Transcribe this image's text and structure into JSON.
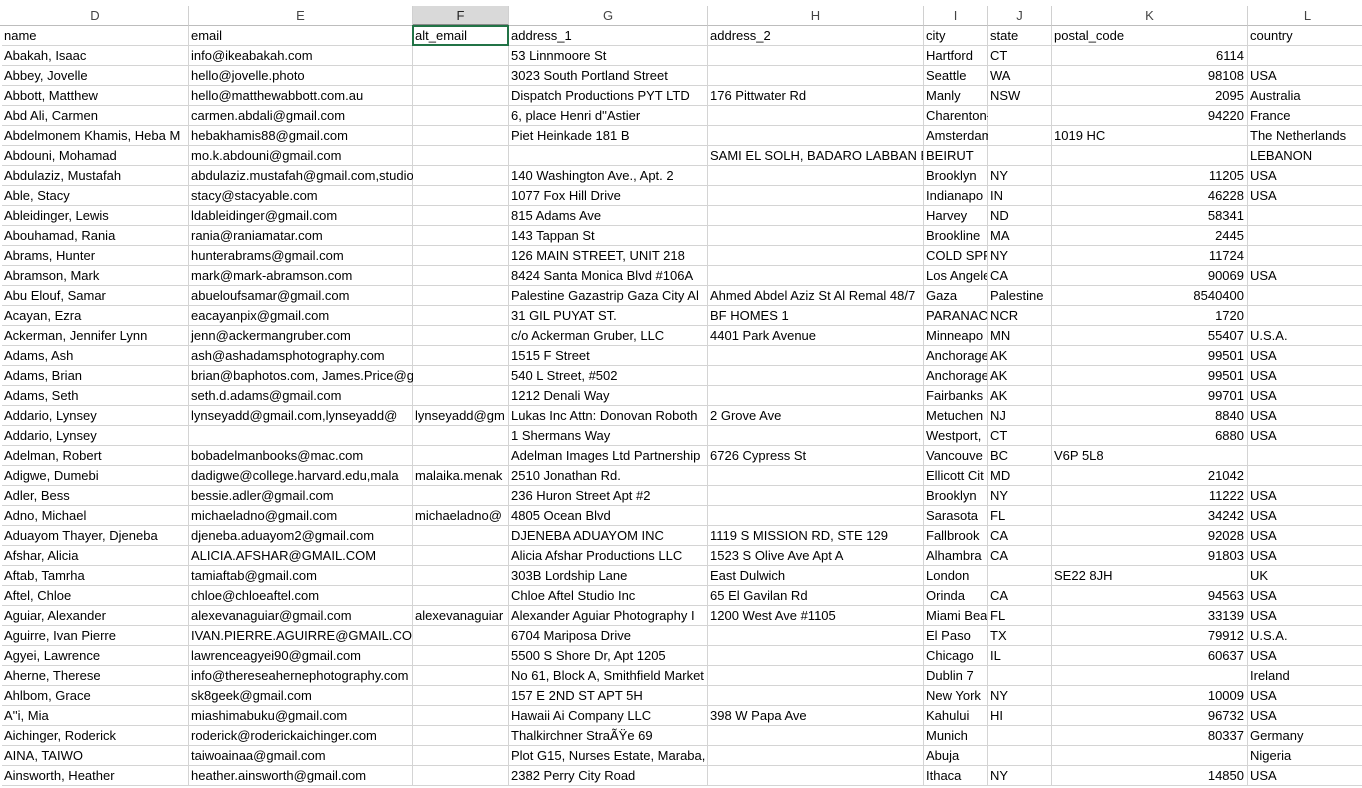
{
  "sheet": {
    "column_letters": [
      "D",
      "E",
      "F",
      "G",
      "H",
      "I",
      "J",
      "K",
      "L"
    ],
    "selected_column": "F",
    "selected_cell": "F1",
    "rows": [
      [
        "name",
        "email",
        "alt_email",
        "address_1",
        "address_2",
        "city",
        "state",
        "postal_code",
        "country"
      ],
      [
        "Abakah, Isaac",
        "info@ikeabakah.com",
        "",
        "53 Linnmoore St",
        "",
        "Hartford",
        "CT",
        "6114",
        ""
      ],
      [
        "Abbey, Jovelle",
        "hello@jovelle.photo",
        "",
        "3023 South Portland Street",
        "",
        "Seattle",
        "WA",
        "98108",
        "USA"
      ],
      [
        "Abbott, Matthew",
        "hello@matthewabbott.com.au",
        "",
        "Dispatch Productions PYT LTD",
        "176 Pittwater Rd",
        "Manly",
        "NSW",
        "2095",
        "Australia"
      ],
      [
        "Abd Ali, Carmen",
        "carmen.abdali@gmail.com",
        "",
        "6, place Henri d''Astier",
        "",
        "Charenton-le-Pont",
        "",
        "94220",
        "France"
      ],
      [
        "Abdelmonem Khamis, Heba M",
        "hebakhamis88@gmail.com",
        "",
        "Piet Heinkade 181 B",
        "",
        "Amsterdam",
        "",
        "1019 HC",
        "The Netherlands"
      ],
      [
        "Abdouni, Mohamad",
        "mo.k.abdouni@gmail.com",
        "",
        "",
        "SAMI EL SOLH, BADARO LABBAN BL",
        "BEIRUT",
        "",
        "",
        "LEBANON"
      ],
      [
        "Abdulaziz, Mustafah",
        "abdulaziz.mustafah@gmail.com,studio@mustafaha",
        "",
        "140 Washington Ave., Apt. 2",
        "",
        "Brooklyn",
        "NY",
        "11205",
        "USA"
      ],
      [
        "Able, Stacy",
        "stacy@stacyable.com",
        "",
        "1077 Fox Hill Drive",
        "",
        "Indianapo",
        "IN",
        "46228",
        "USA"
      ],
      [
        "Ableidinger, Lewis",
        "ldableidinger@gmail.com",
        "",
        "815 Adams Ave",
        "",
        "Harvey",
        "ND",
        "58341",
        ""
      ],
      [
        "Abouhamad, Rania",
        "rania@raniamatar.com",
        "",
        "143 Tappan St",
        "",
        "Brookline",
        "MA",
        "2445",
        ""
      ],
      [
        "Abrams, Hunter",
        "hunterabrams@gmail.com",
        "",
        "126 MAIN STREET, UNIT 218",
        "",
        "COLD SPRI",
        "NY",
        "11724",
        ""
      ],
      [
        "Abramson, Mark",
        "mark@mark-abramson.com",
        "",
        "8424 Santa Monica Blvd #106A",
        "",
        "Los Angele",
        "CA",
        "90069",
        "USA"
      ],
      [
        "Abu Elouf, Samar",
        "abueloufsamar@gmail.com",
        "",
        "Palestine Gazastrip Gaza City Al",
        "Ahmed Abdel Aziz St Al Remal 48/7",
        "Gaza",
        "Palestine",
        "8540400",
        ""
      ],
      [
        "Acayan, Ezra",
        "eacayanpix@gmail.com",
        "",
        "31 GIL PUYAT ST.",
        "BF HOMES 1",
        "PARANAC",
        "NCR",
        "1720",
        ""
      ],
      [
        "Ackerman, Jennifer Lynn",
        "jenn@ackermangruber.com",
        "",
        "c/o Ackerman Gruber, LLC",
        "4401 Park Avenue",
        "Minneapo",
        "MN",
        "55407",
        "U.S.A."
      ],
      [
        "Adams, Ash",
        "ash@ashadamsphotography.com",
        "",
        "1515 F Street",
        "",
        "Anchorage",
        "AK",
        "99501",
        "USA"
      ],
      [
        "Adams, Brian",
        "brian@baphotos.com, James.Price@gettyimages.co",
        "",
        "540 L Street, #502",
        "",
        "Anchorage",
        "AK",
        "99501",
        "USA"
      ],
      [
        "Adams, Seth",
        "seth.d.adams@gmail.com",
        "",
        "1212 Denali Way",
        "",
        "Fairbanks",
        "AK",
        "99701",
        "USA"
      ],
      [
        "Addario, Lynsey",
        "lynseyadd@gmail.com,lynseyadd@",
        "lynseyadd@gm",
        "Lukas Inc Attn: Donovan Roboth",
        "2 Grove Ave",
        "Metuchen",
        "NJ",
        "8840",
        "USA"
      ],
      [
        "Addario, Lynsey",
        "",
        "",
        "1 Shermans Way",
        "",
        "Westport,",
        "CT",
        "6880",
        "USA"
      ],
      [
        "Adelman, Robert",
        "bobadelmanbooks@mac.com",
        "",
        "Adelman Images Ltd Partnership",
        "6726 Cypress St",
        "Vancouve",
        "BC",
        "V6P 5L8",
        ""
      ],
      [
        "Adigwe, Dumebi",
        "dadigwe@college.harvard.edu,mala",
        "malaika.menak",
        "2510 Jonathan Rd.",
        "",
        "Ellicott Cit",
        "MD",
        "21042",
        ""
      ],
      [
        "Adler, Bess",
        "bessie.adler@gmail.com",
        "",
        "236 Huron Street  Apt #2",
        "",
        "Brooklyn",
        "NY",
        "11222",
        "USA"
      ],
      [
        "Adno, Michael",
        "michaeladno@gmail.com",
        "michaeladno@",
        "4805 Ocean Blvd",
        "",
        "Sarasota",
        "FL",
        "34242",
        "USA"
      ],
      [
        "Aduayom Thayer, Djeneba",
        "djeneba.aduayom2@gmail.com",
        "",
        "DJENEBA ADUAYOM INC",
        "1119 S MISSION RD, STE 129",
        "Fallbrook",
        "CA",
        "92028",
        "USA"
      ],
      [
        "Afshar, Alicia",
        "ALICIA.AFSHAR@GMAIL.COM",
        "",
        "Alicia Afshar Productions LLC",
        "1523 S Olive Ave Apt A",
        "Alhambra",
        "CA",
        "91803",
        "USA"
      ],
      [
        "Aftab, Tamrha",
        "tamiaftab@gmail.com",
        "",
        "303B Lordship Lane",
        "East Dulwich",
        "London",
        "",
        "SE22 8JH",
        "UK"
      ],
      [
        "Aftel, Chloe",
        "chloe@chloeaftel.com",
        "",
        "Chloe Aftel Studio Inc",
        "65 El Gavilan Rd",
        "Orinda",
        "CA",
        "94563",
        "USA"
      ],
      [
        "Aguiar, Alexander",
        "alexevanaguiar@gmail.com",
        "alexevanaguiar",
        "Alexander Aguiar Photography I",
        "1200 West Ave #1105",
        "Miami Bea",
        "FL",
        "33139",
        "USA"
      ],
      [
        "Aguirre, Ivan Pierre",
        "IVAN.PIERRE.AGUIRRE@GMAIL.COM",
        "",
        "6704 Mariposa Drive",
        "",
        "El Paso",
        "TX",
        "79912",
        "U.S.A."
      ],
      [
        "Agyei, Lawrence",
        "lawrenceagyei90@gmail.com",
        "",
        "5500 S Shore Dr, Apt 1205",
        "",
        "Chicago",
        "IL",
        "60637",
        "USA"
      ],
      [
        "Aherne, Therese",
        "info@thereseahernephotography.com",
        "",
        "No 61, Block A, Smithfield Market",
        "",
        "Dublin 7",
        "",
        "",
        "Ireland"
      ],
      [
        "Ahlbom, Grace",
        "sk8geek@gmail.com",
        "",
        "157 E 2ND ST APT 5H",
        "",
        "New York",
        "NY",
        "10009",
        "USA"
      ],
      [
        "A''i, Mia",
        "miashimabuku@gmail.com",
        "",
        "Hawaii Ai Company LLC",
        "398 W Papa Ave",
        "Kahului",
        "HI",
        "96732",
        "USA"
      ],
      [
        "Aichinger, Roderick",
        "roderick@roderickaichinger.com",
        "",
        "Thalkirchner StraÃŸe 69",
        "",
        "Munich",
        "",
        "80337",
        "Germany"
      ],
      [
        "AINA, TAIWO",
        "taiwoainaa@gmail.com",
        "",
        "Plot G15, Nurses Estate, Maraba,",
        "",
        "Abuja",
        "",
        "",
        "Nigeria"
      ],
      [
        "Ainsworth, Heather",
        "heather.ainsworth@gmail.com",
        "",
        "2382 Perry City Road",
        "",
        "Ithaca",
        "NY",
        "14850",
        "USA"
      ]
    ]
  }
}
